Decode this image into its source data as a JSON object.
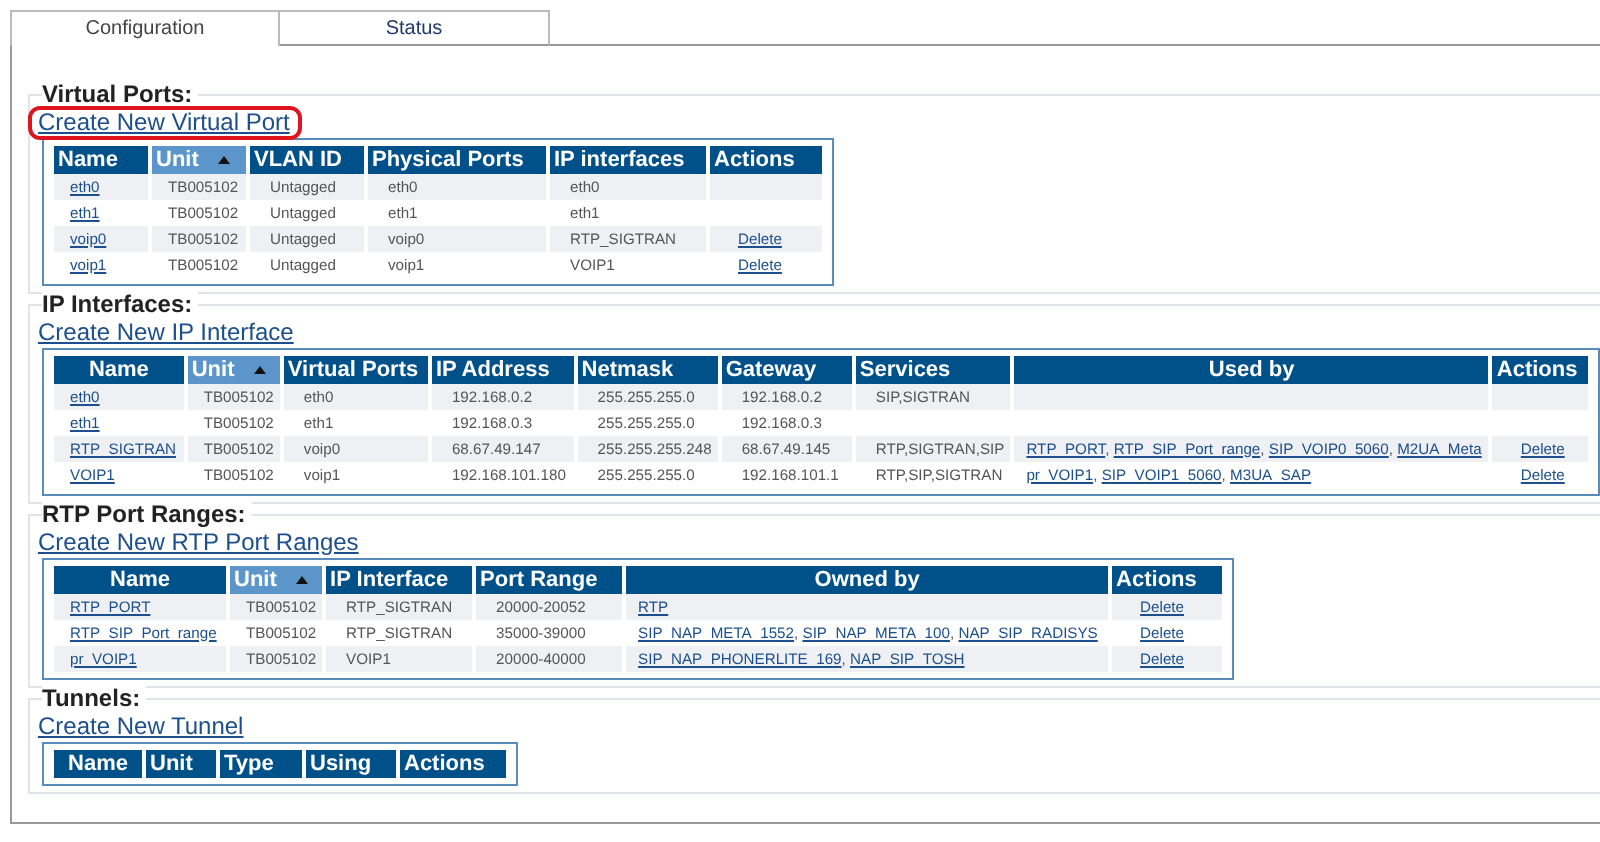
{
  "tabs": [
    {
      "label": "Configuration",
      "selected": true
    },
    {
      "label": "Status",
      "selected": false
    }
  ],
  "sections": [
    {
      "title": "Virtual Ports:",
      "create_link": {
        "label": "Create New Virtual Port",
        "highlighted": true
      },
      "columns": [
        {
          "label": "Name",
          "kind": "link",
          "sorted": false
        },
        {
          "label": "Unit",
          "kind": "text",
          "sorted": true
        },
        {
          "label": "VLAN ID",
          "kind": "text",
          "sorted": false
        },
        {
          "label": "Physical Ports",
          "kind": "text",
          "sorted": false
        },
        {
          "label": "IP interfaces",
          "kind": "text",
          "sorted": false
        },
        {
          "label": "Actions",
          "kind": "link",
          "sorted": false
        }
      ],
      "rows": [
        [
          "eth0",
          "TB005102",
          "Untagged",
          "eth0",
          "eth0",
          null
        ],
        [
          "eth1",
          "TB005102",
          "Untagged",
          "eth1",
          "eth1",
          null
        ],
        [
          "voip0",
          "TB005102",
          "Untagged",
          "voip0",
          "RTP_SIGTRAN",
          "Delete"
        ],
        [
          "voip1",
          "TB005102",
          "Untagged",
          "voip1",
          "VOIP1",
          "Delete"
        ]
      ]
    },
    {
      "title": "IP Interfaces:",
      "create_link": {
        "label": "Create New IP Interface",
        "highlighted": false
      },
      "columns": [
        {
          "label": "Name",
          "kind": "link",
          "sorted": false
        },
        {
          "label": "Unit",
          "kind": "text",
          "sorted": true
        },
        {
          "label": "Virtual Ports",
          "kind": "text",
          "sorted": false
        },
        {
          "label": "IP Address",
          "kind": "text",
          "sorted": false
        },
        {
          "label": "Netmask",
          "kind": "text",
          "sorted": false
        },
        {
          "label": "Gateway",
          "kind": "text",
          "sorted": false
        },
        {
          "label": "Services",
          "kind": "text",
          "sorted": false
        },
        {
          "label": "Used by",
          "kind": "links",
          "sorted": false,
          "separator": ","
        },
        {
          "label": "Actions",
          "kind": "link",
          "sorted": false
        }
      ],
      "rows": [
        [
          "eth0",
          "TB005102",
          "eth0",
          "192.168.0.2",
          "255.255.255.0",
          "192.168.0.2",
          "SIP,SIGTRAN",
          null,
          null
        ],
        [
          "eth1",
          "TB005102",
          "eth1",
          "192.168.0.3",
          "255.255.255.0",
          "192.168.0.3",
          null,
          null,
          null
        ],
        [
          "RTP_SIGTRAN",
          "TB005102",
          "voip0",
          "68.67.49.147",
          "255.255.255.248",
          "68.67.49.145",
          "RTP,SIGTRAN,SIP",
          [
            "RTP_PORT",
            "RTP_SIP_Port_range",
            "SIP_VOIP0_5060",
            "M2UA_Meta"
          ],
          "Delete"
        ],
        [
          "VOIP1",
          "TB005102",
          "voip1",
          "192.168.101.180",
          "255.255.255.0",
          "192.168.101.1",
          "RTP,SIP,SIGTRAN",
          [
            "pr_VOIP1",
            "SIP_VOIP1_5060",
            "M3UA_SAP"
          ],
          "Delete"
        ]
      ]
    },
    {
      "title": "RTP Port Ranges:",
      "create_link": {
        "label": "Create New RTP Port Ranges",
        "highlighted": false
      },
      "columns": [
        {
          "label": "Name",
          "kind": "link",
          "sorted": false
        },
        {
          "label": "Unit",
          "kind": "text",
          "sorted": true
        },
        {
          "label": "IP Interface",
          "kind": "text",
          "sorted": false
        },
        {
          "label": "Port Range",
          "kind": "text",
          "sorted": false
        },
        {
          "label": "Owned by",
          "kind": "links",
          "sorted": false,
          "separator": ","
        },
        {
          "label": "Actions",
          "kind": "link",
          "sorted": false
        }
      ],
      "rows": [
        [
          "RTP_PORT",
          "TB005102",
          "RTP_SIGTRAN",
          "20000-20052",
          [
            "RTP"
          ],
          "Delete"
        ],
        [
          "RTP_SIP_Port_range",
          "TB005102",
          "RTP_SIGTRAN",
          "35000-39000",
          [
            "SIP_NAP_META_1552",
            "SIP_NAP_META_100",
            "NAP_SIP_RADISYS"
          ],
          "Delete"
        ],
        [
          "pr_VOIP1",
          "TB005102",
          "VOIP1",
          "20000-40000",
          [
            "SIP_NAP_PHONERLITE_169",
            "NAP_SIP_TOSH"
          ],
          "Delete"
        ]
      ]
    },
    {
      "title": "Tunnels:",
      "create_link": {
        "label": "Create New Tunnel",
        "highlighted": false
      },
      "columns": [
        {
          "label": "Name",
          "kind": "text",
          "sorted": false
        },
        {
          "label": "Unit",
          "kind": "text",
          "sorted": false
        },
        {
          "label": "Type",
          "kind": "text",
          "sorted": false
        },
        {
          "label": "Using",
          "kind": "text",
          "sorted": false
        },
        {
          "label": "Actions",
          "kind": "text",
          "sorted": false
        }
      ]
    }
  ]
}
